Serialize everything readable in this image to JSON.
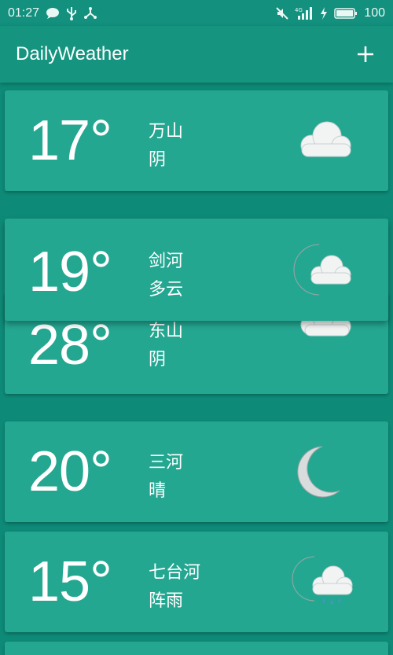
{
  "status": {
    "time": "01:27",
    "battery": "100"
  },
  "app": {
    "title": "DailyWeather"
  },
  "cards": [
    {
      "temp": "17°",
      "city": "万山",
      "condition": "阴",
      "icon": "cloudy-icon"
    },
    {
      "temp": "19°",
      "city": "剑河",
      "condition": "多云",
      "icon": "partly-cloudy-night-icon"
    },
    {
      "temp": "28°",
      "city": "东山",
      "condition": "阴",
      "icon": "cloudy-icon"
    },
    {
      "temp": "20°",
      "city": "三河",
      "condition": "晴",
      "icon": "moon-icon"
    },
    {
      "temp": "15°",
      "city": "七台河",
      "condition": "阵雨",
      "icon": "showers-night-icon"
    }
  ],
  "colors": {
    "background": "#0e8b78",
    "appbar": "#15957f",
    "card": "#24a791"
  }
}
